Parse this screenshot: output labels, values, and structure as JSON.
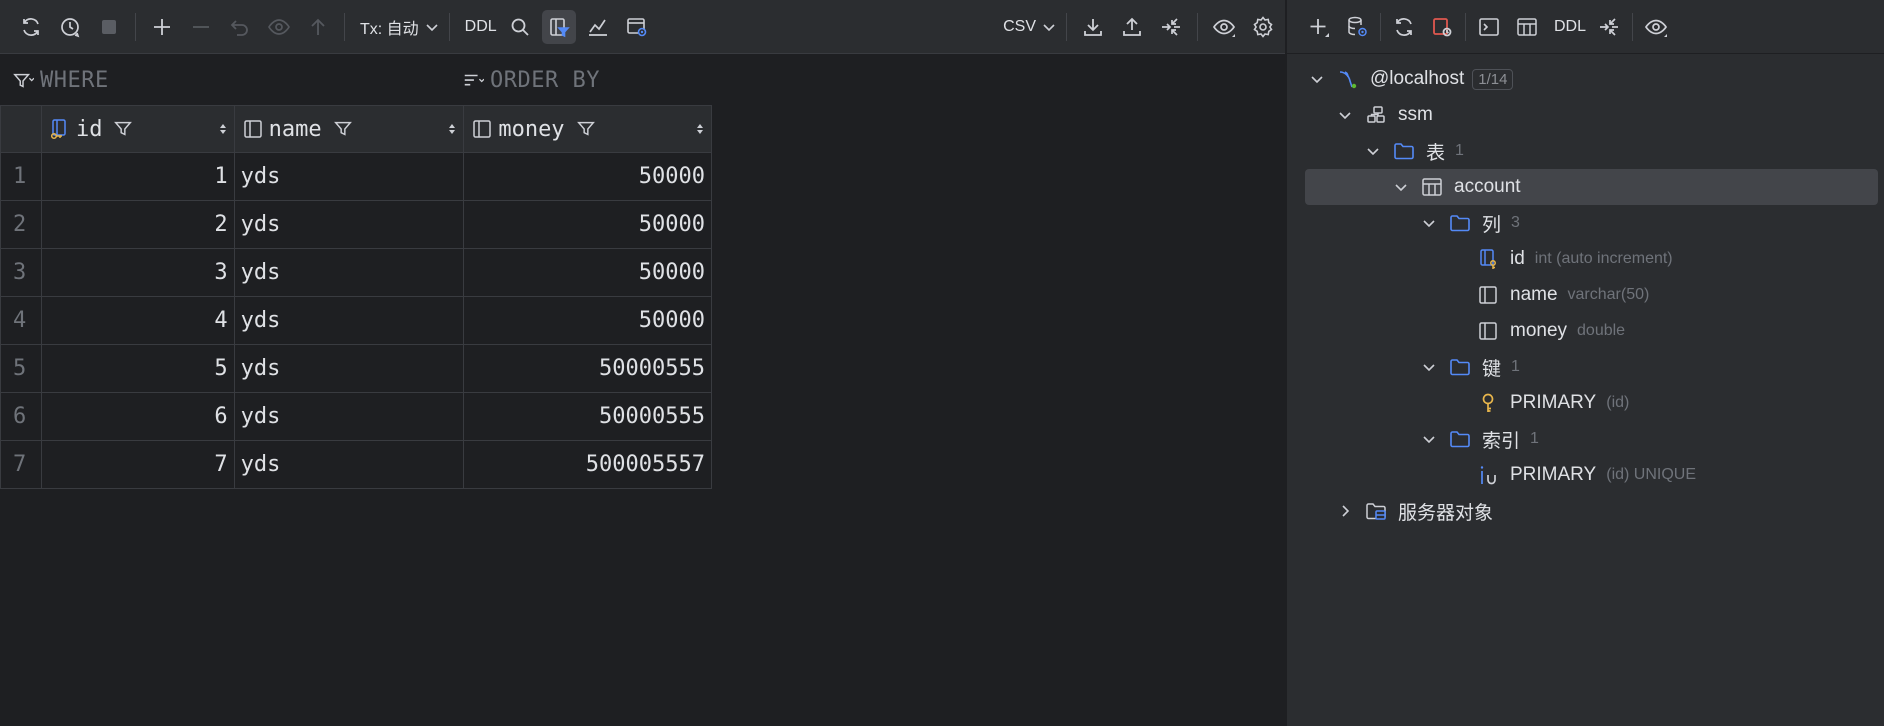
{
  "toolbar": {
    "tx_label": "Tx: 自动",
    "ddl_label": "DDL",
    "export_format": "CSV",
    "icons": [
      "refresh-icon",
      "history-icon",
      "stop-icon",
      "add-row-icon",
      "remove-row-icon",
      "undo-icon",
      "preview-icon",
      "submit-icon",
      "search-icon",
      "filter-panel-icon",
      "chart-icon",
      "view-query-icon",
      "download-icon",
      "upload-icon",
      "compare-icon",
      "eye-icon",
      "gear-icon"
    ]
  },
  "filters": {
    "where_label": "WHERE",
    "order_by_label": "ORDER BY"
  },
  "grid": {
    "columns": [
      {
        "name": "id",
        "kind": "key-column"
      },
      {
        "name": "name",
        "kind": "column"
      },
      {
        "name": "money",
        "kind": "column"
      }
    ],
    "rows": [
      {
        "num": "1",
        "id": "1",
        "name": "yds",
        "money": "50000"
      },
      {
        "num": "2",
        "id": "2",
        "name": "yds",
        "money": "50000"
      },
      {
        "num": "3",
        "id": "3",
        "name": "yds",
        "money": "50000"
      },
      {
        "num": "4",
        "id": "4",
        "name": "yds",
        "money": "50000"
      },
      {
        "num": "5",
        "id": "5",
        "name": "yds",
        "money": "50000555"
      },
      {
        "num": "6",
        "id": "6",
        "name": "yds",
        "money": "50000555"
      },
      {
        "num": "7",
        "id": "7",
        "name": "yds",
        "money": "500005557"
      }
    ]
  },
  "right_toolbar": {
    "ddl_label": "DDL"
  },
  "tree": {
    "host": {
      "label": "@localhost",
      "badge": "1/14"
    },
    "schema": {
      "label": "ssm"
    },
    "tables_folder": {
      "label": "表",
      "count": "1"
    },
    "table": {
      "label": "account"
    },
    "columns_folder": {
      "label": "列",
      "count": "3"
    },
    "columns": [
      {
        "name": "id",
        "type": "int (auto increment)"
      },
      {
        "name": "name",
        "type": "varchar(50)"
      },
      {
        "name": "money",
        "type": "double"
      }
    ],
    "keys_folder": {
      "label": "键",
      "count": "1"
    },
    "key": {
      "name": "PRIMARY",
      "detail": "(id)"
    },
    "indexes_folder": {
      "label": "索引",
      "count": "1"
    },
    "index": {
      "name": "PRIMARY",
      "detail": "(id) UNIQUE"
    },
    "server_objects": {
      "label": "服务器对象"
    }
  },
  "colors": {
    "background": "#1e1f22",
    "panel": "#2b2d30",
    "text": "#dfe1e5",
    "muted": "#6f737a",
    "accent_blue": "#548af7",
    "key_yellow": "#e8b64c",
    "stop_red": "#e0584f"
  }
}
